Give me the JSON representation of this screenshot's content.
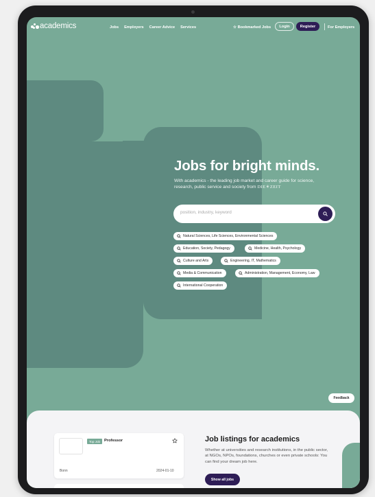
{
  "header": {
    "logo_text": "academics",
    "nav": [
      "Jobs",
      "Employers",
      "Career Advice",
      "Services"
    ],
    "bookmarked": "☆ Bookmarked Jobs",
    "login": "Login",
    "register": "Register",
    "for_employers": "For Employers"
  },
  "hero": {
    "title": "Jobs for bright minds.",
    "subtitle": "With academics - the leading job market and career guide for science, research, public service and society from",
    "brand": "DIE☀ZEIT",
    "search_placeholder": "position, industry, keyword",
    "categories": [
      "Natural Sciences, Life Sciences, Environmental Sciences",
      "Education, Society, Pedagogy",
      "Medicine, Health, Psychology",
      "Culture and Arts",
      "Engineering, IT, Mathematics",
      "Media & Communication",
      "Administration, Management, Economy, Law",
      "International Cooperation"
    ]
  },
  "feedback": "Feedback",
  "job_card": {
    "badge": "Top Job",
    "title": "Professor",
    "location": "Bonn",
    "date": "2024-01-10"
  },
  "listings": {
    "title": "Job listings for academics",
    "text": "Whether at universities and research institutions, in the public sector, at NGOs, NPOs, foundations, churches or even private schools: You can find your dream job here.",
    "button": "Show all jobs"
  },
  "colors": {
    "primary_green": "#78aa97",
    "dark_green_shape": "#5e8a80",
    "accent_purple": "#2e1d56"
  }
}
